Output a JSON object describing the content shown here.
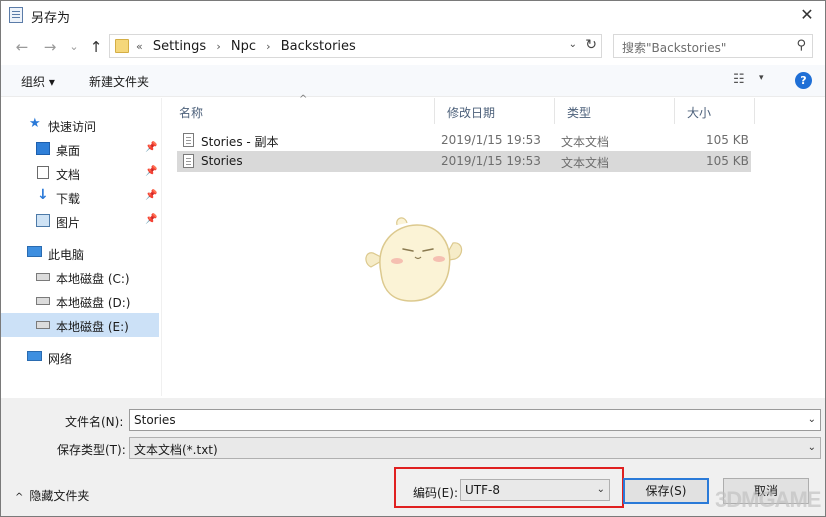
{
  "window": {
    "title": "另存为",
    "close_glyph": "✕"
  },
  "nav": {
    "back_glyph": "←",
    "forward_glyph": "→",
    "recent_glyph": "⌄",
    "up_glyph": "↑"
  },
  "address": {
    "overflow": "«",
    "crumbs": [
      "Settings",
      "Npc",
      "Backstories"
    ],
    "separator": "›",
    "dropdown_glyph": "⌄",
    "refresh_glyph": "↻"
  },
  "search": {
    "placeholder": "搜索\"Backstories\"",
    "icon_glyph": "⚲"
  },
  "toolbar": {
    "organize_label": "组织 ▾",
    "new_folder_label": "新建文件夹",
    "view_glyph": "☷",
    "view_dd_glyph": "▾",
    "help_glyph": "?"
  },
  "sidebar": {
    "pin_glyph": "📌",
    "items": [
      {
        "label": "快速访问",
        "icon": "star-icon",
        "glyph": "★"
      },
      {
        "label": "桌面",
        "icon": "desktop-icon",
        "pinned": true
      },
      {
        "label": "文档",
        "icon": "document-icon",
        "pinned": true
      },
      {
        "label": "下载",
        "icon": "download-icon",
        "glyph": "↓",
        "pinned": true
      },
      {
        "label": "图片",
        "icon": "picture-icon",
        "pinned": true
      },
      {
        "label": "此电脑",
        "icon": "computer-icon"
      },
      {
        "label": "本地磁盘 (C:)",
        "icon": "disk-icon"
      },
      {
        "label": "本地磁盘 (D:)",
        "icon": "disk-icon"
      },
      {
        "label": "本地磁盘 (E:)",
        "icon": "disk-icon",
        "selected": true
      },
      {
        "label": "网络",
        "icon": "network-icon"
      }
    ]
  },
  "columns": {
    "name": "名称",
    "modified": "修改日期",
    "type": "类型",
    "size": "大小",
    "sort_glyph": "^"
  },
  "files": [
    {
      "name": "Stories - 副本",
      "modified": "2019/1/15 19:53",
      "type": "文本文档",
      "size": "105 KB",
      "selected": false
    },
    {
      "name": "Stories",
      "modified": "2019/1/15 19:53",
      "type": "文本文档",
      "size": "105 KB",
      "selected": true
    }
  ],
  "form": {
    "filename_label": "文件名(N):",
    "filename_value": "Stories",
    "filetype_label": "保存类型(T):",
    "filetype_value": "文本文档(*.txt)",
    "dd_glyph": "⌄",
    "hide_folders_chev": "^",
    "hide_folders_label": "隐藏文件夹",
    "encoding_label": "编码(E):",
    "encoding_value": "UTF-8",
    "save_label": "保存(S)",
    "cancel_label": "取消"
  },
  "watermark": {
    "text": "3DMGAME"
  },
  "colors": {
    "highlight": "#e02020",
    "selection": "#cce1f7",
    "accent": "#2a7ad8"
  }
}
